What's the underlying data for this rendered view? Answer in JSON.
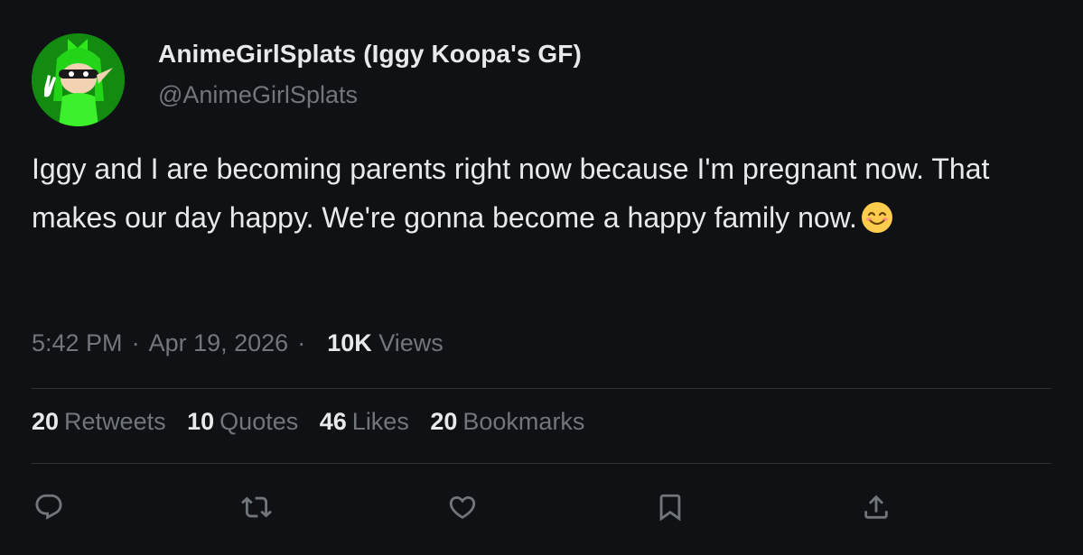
{
  "author": {
    "display_name": "AnimeGirlSplats (Iggy Koopa's GF)",
    "handle": "@AnimeGirlSplats",
    "avatar_icon": "inkling-girl-avatar"
  },
  "tweet": {
    "text": "Iggy and I are becoming parents right now because I'm pregnant now. That makes our day happy. We're gonna become a happy family now.",
    "emoji": "smiling-face-emoji"
  },
  "meta": {
    "time": "5:42 PM",
    "date": "Apr 19, 2026",
    "views_count": "10K",
    "views_label": "Views"
  },
  "stats": [
    {
      "count": "20",
      "label": "Retweets"
    },
    {
      "count": "10",
      "label": "Quotes"
    },
    {
      "count": "46",
      "label": "Likes"
    },
    {
      "count": "20",
      "label": "Bookmarks"
    }
  ],
  "actions": [
    "reply-icon",
    "retweet-icon",
    "like-icon",
    "bookmark-icon",
    "share-icon"
  ],
  "colors": {
    "background": "#0f1114",
    "text_primary": "#e7e9ea",
    "text_secondary": "#71767b",
    "divider": "#2f3336",
    "avatar_green": "#138a10"
  }
}
